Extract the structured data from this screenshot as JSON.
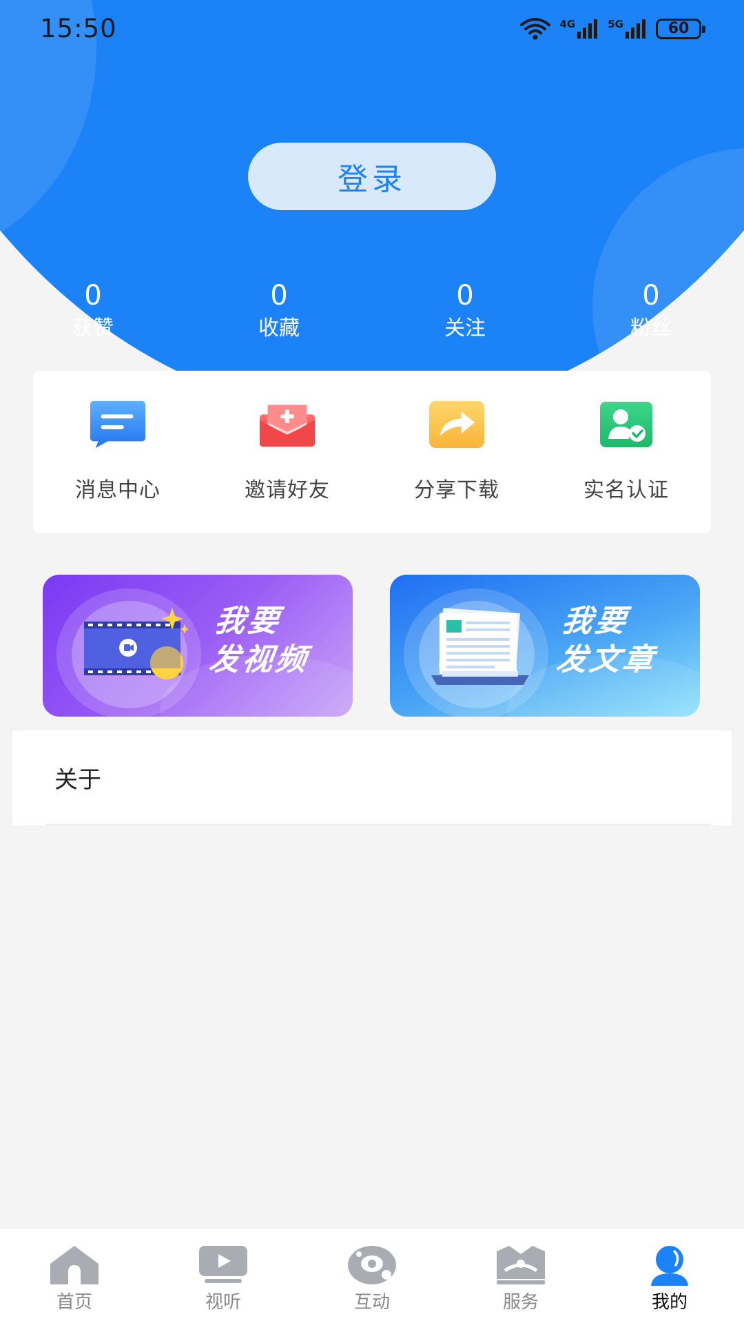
{
  "status_bar": {
    "time": "15:50",
    "network_1": "4G",
    "network_2": "5G",
    "battery": "60"
  },
  "login_label": "登录",
  "stats": [
    {
      "value": "0",
      "label": "获赞"
    },
    {
      "value": "0",
      "label": "收藏"
    },
    {
      "value": "0",
      "label": "关注"
    },
    {
      "value": "0",
      "label": "粉丝"
    }
  ],
  "actions": [
    {
      "label": "消息中心",
      "icon": "message-icon"
    },
    {
      "label": "邀请好友",
      "icon": "invite-icon"
    },
    {
      "label": "分享下载",
      "icon": "share-icon"
    },
    {
      "label": "实名认证",
      "icon": "verify-icon"
    }
  ],
  "banners": {
    "video": {
      "line1": "我要",
      "line2": "发视频"
    },
    "article": {
      "line1": "我要",
      "line2": "发文章"
    }
  },
  "list": {
    "about": "关于"
  },
  "nav": [
    {
      "label": "首页",
      "icon": "home-icon",
      "active": false
    },
    {
      "label": "视听",
      "icon": "play-icon",
      "active": false
    },
    {
      "label": "互动",
      "icon": "interact-icon",
      "active": false
    },
    {
      "label": "服务",
      "icon": "service-icon",
      "active": false
    },
    {
      "label": "我的",
      "icon": "profile-icon",
      "active": true
    }
  ],
  "colors": {
    "primary": "#1c82f7",
    "page_bg": "#f4f4f5",
    "login_bg": "#d7e9fb"
  }
}
